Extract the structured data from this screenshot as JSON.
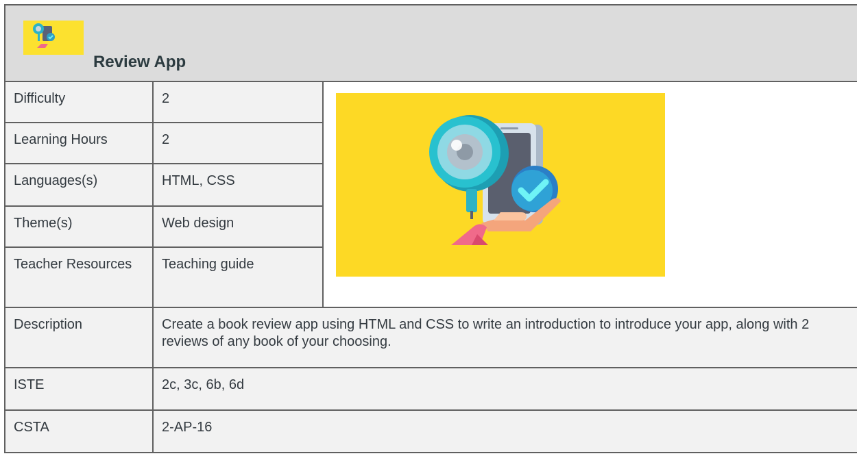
{
  "header": {
    "title": "Review App",
    "logo_icon": "review-app-logo-icon"
  },
  "rows": [
    {
      "label": "Difficulty",
      "value": "2"
    },
    {
      "label": "Learning Hours",
      "value": "2"
    },
    {
      "label": "Languages(s)",
      "value": "HTML, CSS"
    },
    {
      "label": "Theme(s)",
      "value": "Web design"
    },
    {
      "label": "Teacher Resources",
      "value": "Teaching guide"
    }
  ],
  "description": {
    "label": "Description",
    "value": "Create a book review app using HTML and CSS to write an introduction to introduce your app, along with 2 reviews of any book of your choosing."
  },
  "iste": {
    "label": "ISTE",
    "value": "2c, 3c, 6b, 6d"
  },
  "csta": {
    "label": "CSTA",
    "value": "2-AP-16"
  },
  "hero": {
    "icon": "magnifier-phone-checkmark-icon",
    "background": "#fdd925"
  },
  "colors": {
    "header_bg": "#dcdcdc",
    "cell_bg": "#f2f2f2",
    "border": "#606060",
    "accent": "#fce12f"
  }
}
